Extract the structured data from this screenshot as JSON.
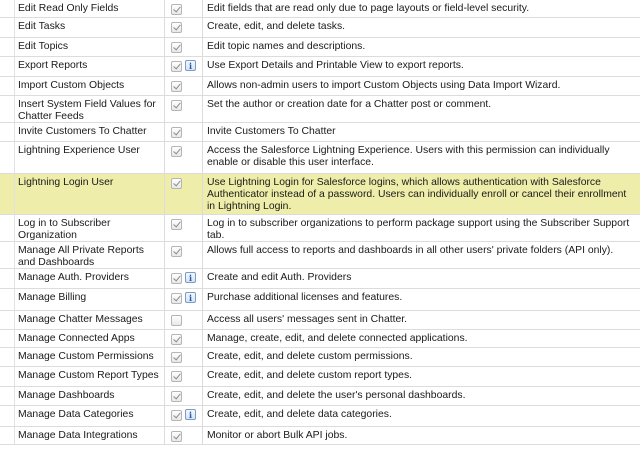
{
  "permissions": [
    {
      "name": "Edit Read Only Fields",
      "checked": true,
      "info": false,
      "description": "Edit fields that are read only due to page layouts or field-level security."
    },
    {
      "name": "Edit Tasks",
      "checked": true,
      "info": false,
      "description": "Create, edit, and delete tasks."
    },
    {
      "name": "Edit Topics",
      "checked": true,
      "info": false,
      "description": "Edit topic names and descriptions."
    },
    {
      "name": "Export Reports",
      "checked": true,
      "info": true,
      "description": "Use Export Details and Printable View to export reports."
    },
    {
      "name": "Import Custom Objects",
      "checked": true,
      "info": false,
      "description": "Allows non-admin users to import Custom Objects using Data Import Wizard."
    },
    {
      "name": "Insert System Field Values for Chatter Feeds",
      "checked": true,
      "info": false,
      "description": "Set the author or creation date for a Chatter post or comment."
    },
    {
      "name": "Invite Customers To Chatter",
      "checked": true,
      "info": false,
      "description": "Invite Customers To Chatter"
    },
    {
      "name": "Lightning Experience User",
      "checked": true,
      "info": false,
      "description": "Access the Salesforce Lightning Experience. Users with this permission can individually enable or disable this user interface."
    },
    {
      "name": "Lightning Login User",
      "checked": true,
      "info": false,
      "highlight": true,
      "description": "Use Lightning Login for Salesforce logins, which allows authentication with Salesforce Authenticator instead of a password. Users can individually enroll or cancel their enrollment in Lightning Login."
    },
    {
      "name": "Log in to Subscriber Organization",
      "checked": true,
      "info": false,
      "description": "Log in to subscriber organizations to perform package support using the Subscriber Support tab."
    },
    {
      "name": "Manage All Private Reports and Dashboards",
      "checked": true,
      "info": false,
      "description": "Allows full access to reports and dashboards in all other users' private folders (API only)."
    },
    {
      "name": "Manage Auth. Providers",
      "checked": true,
      "info": true,
      "description": "Create and edit Auth. Providers"
    },
    {
      "name": "Manage Billing",
      "checked": true,
      "info": true,
      "description": "Purchase additional licenses and features."
    },
    {
      "name": "Manage Chatter Messages",
      "checked": false,
      "info": false,
      "description": "Access all users' messages sent in Chatter."
    },
    {
      "name": "Manage Connected Apps",
      "checked": true,
      "info": false,
      "description": "Manage, create, edit, and delete connected applications."
    },
    {
      "name": "Manage Custom Permissions",
      "checked": true,
      "info": false,
      "description": "Create, edit, and delete custom permissions."
    },
    {
      "name": "Manage Custom Report Types",
      "checked": true,
      "info": false,
      "description": "Create, edit, and delete custom report types."
    },
    {
      "name": "Manage Dashboards",
      "checked": true,
      "info": false,
      "description": "Create, edit, and delete the user's personal dashboards."
    },
    {
      "name": "Manage Data Categories",
      "checked": true,
      "info": true,
      "description": "Create, edit, and delete data categories."
    },
    {
      "name": "Manage Data Integrations",
      "checked": true,
      "info": false,
      "description": "Monitor or abort Bulk API jobs."
    }
  ],
  "icons": {
    "checkbox": "checkbox-icon",
    "info": "info-icon"
  },
  "colors": {
    "highlight": "#eeeeaa",
    "grid": "#dcdcdc"
  }
}
